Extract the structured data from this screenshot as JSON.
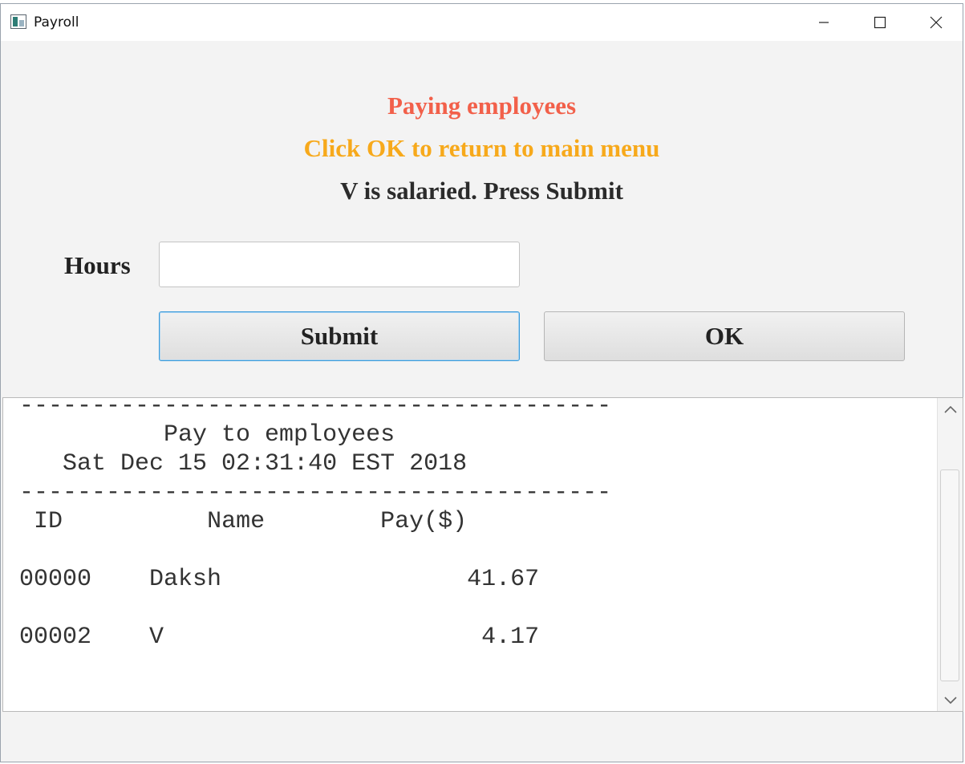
{
  "window": {
    "title": "Payroll",
    "controls": [
      "minimize-icon",
      "maximize-icon",
      "close-icon"
    ]
  },
  "headings": {
    "title": "Paying employees",
    "instruction": "Click OK to return to main menu",
    "status": "V is salaried. Press Submit"
  },
  "form": {
    "hours_label": "Hours",
    "hours_value": "",
    "submit_label": "Submit",
    "ok_label": "OK"
  },
  "report": {
    "separator": "-----------------------------------------",
    "title": "Pay to employees",
    "date": "Sat Dec 15 02:31:40 EST 2018",
    "columns": [
      "ID",
      "Name",
      "Pay($)"
    ],
    "rows": [
      {
        "id": "00000",
        "name": "Daksh",
        "pay": "41.67"
      },
      {
        "id": "00002",
        "name": "V",
        "pay": "4.17"
      }
    ]
  },
  "colors": {
    "title": "#f2604a",
    "instruction": "#f7a91b",
    "status": "#2b2b2b",
    "submit_focus_border": "#3a9ad9"
  }
}
